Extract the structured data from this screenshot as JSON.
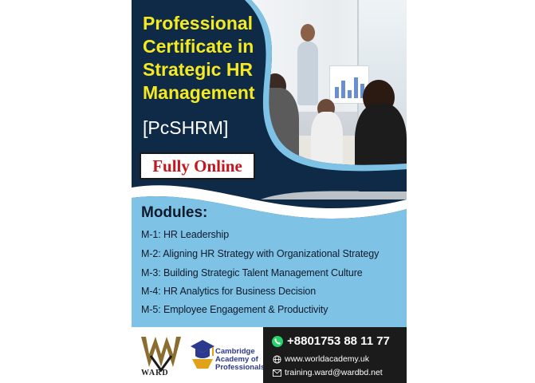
{
  "poster": {
    "title": "Professional Certificate in Strategic HR Management",
    "abbreviation": "[PcSHRM]",
    "mode_badge": "Fully Online",
    "modules_heading": "Modules:",
    "modules": [
      "M-1: HR Leadership",
      "M-2: Aligning HR Strategy with Organizational Strategy",
      "M-3: Building Strategic Talent Management Culture",
      "M-4: HR Analytics for Business Decision",
      "M-5: Employee Engagement & Productivity"
    ]
  },
  "logos": {
    "ward": "WARD",
    "cambridge": [
      "Cambridge",
      "Academy of",
      "Professionals"
    ]
  },
  "contact": {
    "phone": "+8801753 88 11 77",
    "website": "www.worldacademy.uk",
    "email": "training.ward@wardbd.net"
  },
  "colors": {
    "navy": "#0e2a47",
    "light_blue": "#7ec3e6",
    "title_yellow": "#f5ea22",
    "badge_red": "#c4161c",
    "contact_bar": "#1b1b1b",
    "whatsapp_green": "#25d366"
  },
  "icons": [
    "whatsapp-icon",
    "globe-icon",
    "mail-icon",
    "graduation-cap-icon",
    "ward-logo"
  ]
}
